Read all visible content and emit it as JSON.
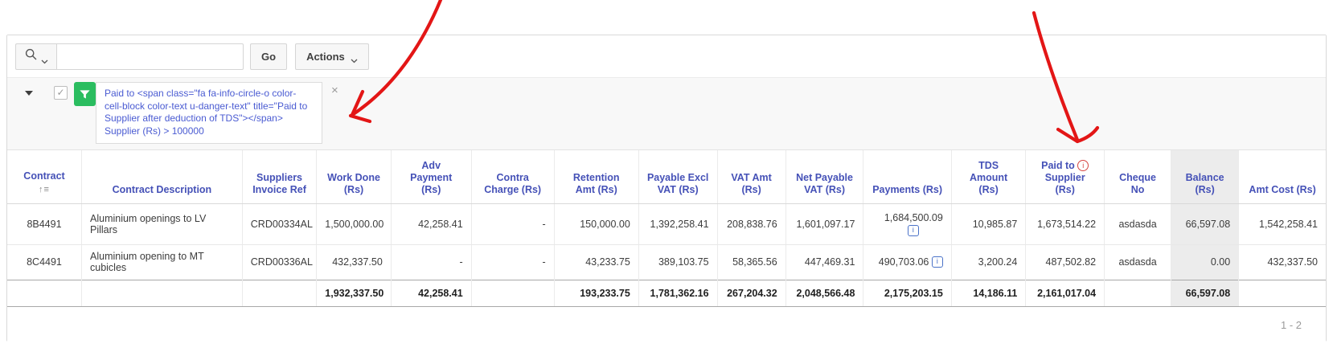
{
  "toolbar": {
    "search_placeholder": "",
    "search_value": "",
    "go_label": "Go",
    "actions_label": "Actions"
  },
  "filter_region": {
    "filter_text": "Paid to <span class=\"fa fa-info-circle-o color-cell-block color-text u-danger-text\" title=\"Paid to Supplier after deduction of TDS\"></span> Supplier (Rs) > 100000",
    "close_glyph": "×",
    "checkbox_check_glyph": "✓"
  },
  "icons": {
    "sort_ascending_glyph": "↑≡",
    "info_glyph": "i"
  },
  "table": {
    "headers": {
      "contract": "Contract",
      "description": "Contract Description",
      "invoice_ref": "Suppliers Invoice Ref",
      "work_done": "Work Done (Rs)",
      "adv_payment": "Adv Payment (Rs)",
      "contra_charge": "Contra Charge (Rs)",
      "retention_amt": "Retention Amt (Rs)",
      "payable_excl_vat": "Payable Excl VAT (Rs)",
      "vat_amt": "VAT Amt (Rs)",
      "net_payable_vat": "Net Payable VAT (Rs)",
      "payments": "Payments (Rs)",
      "tds_amount": "TDS Amount (Rs)",
      "paid_to_line1": "Paid to",
      "paid_to_line2": "Supplier (Rs)",
      "cheque_no": "Cheque No",
      "balance": "Balance (Rs)",
      "amt_cost": "Amt Cost (Rs)"
    },
    "rows": [
      {
        "contract": "8B4491",
        "description": "Aluminium openings to LV Pillars",
        "invoice_ref": "CRD00334AL",
        "work_done": "1,500,000.00",
        "adv_payment": "42,258.41",
        "contra_charge": "-",
        "retention_amt": "150,000.00",
        "payable_excl_vat": "1,392,258.41",
        "vat_amt": "208,838.76",
        "net_payable_vat": "1,601,097.17",
        "payments": "1,684,500.09",
        "tds_amount": "10,985.87",
        "paid_to_supplier": "1,673,514.22",
        "cheque_no": "asdasda",
        "balance": "66,597.08",
        "amt_cost": "1,542,258.41"
      },
      {
        "contract": "8C4491",
        "description": "Aluminium opening to MT cubicles",
        "invoice_ref": "CRD00336AL",
        "work_done": "432,337.50",
        "adv_payment": "-",
        "contra_charge": "-",
        "retention_amt": "43,233.75",
        "payable_excl_vat": "389,103.75",
        "vat_amt": "58,365.56",
        "net_payable_vat": "447,469.31",
        "payments": "490,703.06",
        "tds_amount": "3,200.24",
        "paid_to_supplier": "487,502.82",
        "cheque_no": "asdasda",
        "balance": "0.00",
        "amt_cost": "432,337.50"
      }
    ],
    "totals": {
      "contract": "",
      "description": "",
      "invoice_ref": "",
      "work_done": "1,932,337.50",
      "adv_payment": "42,258.41",
      "contra_charge": "",
      "retention_amt": "193,233.75",
      "payable_excl_vat": "1,781,362.16",
      "vat_amt": "267,204.32",
      "net_payable_vat": "2,048,566.48",
      "payments": "2,175,203.15",
      "tds_amount": "14,186.11",
      "paid_to_supplier": "2,161,017.04",
      "cheque_no": "",
      "balance": "66,597.08",
      "amt_cost": ""
    }
  },
  "pagination": {
    "range_label": "1 - 2"
  },
  "colors": {
    "header_text": "#4551b7",
    "filter_text": "#4a5bd2",
    "filter_icon_bg": "#2bbd60",
    "danger_icon": "#d64541",
    "info_icon": "#4a72c8",
    "balance_column_bg": "#ececec",
    "annotation_arrow": "#e31616"
  }
}
